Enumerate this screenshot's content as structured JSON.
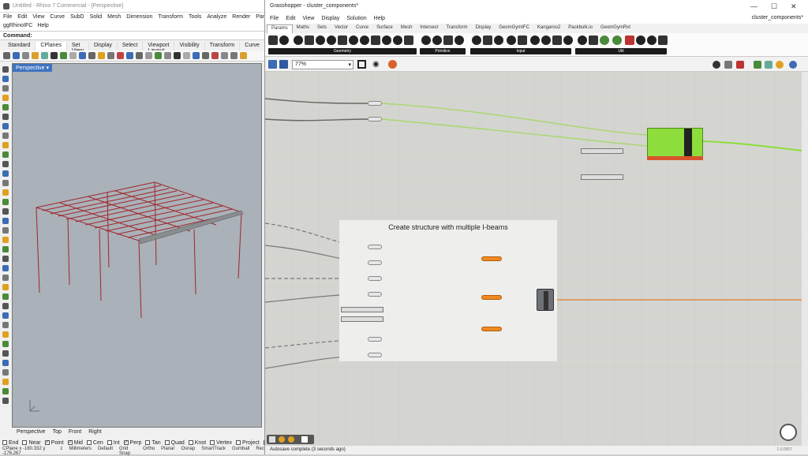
{
  "rhino": {
    "title": "Untitled - Rhino 7 Commercial - [Perspective]",
    "menu": [
      "File",
      "Edit",
      "View",
      "Curve",
      "SubD",
      "Solid",
      "Mesh",
      "Dimension",
      "Transform",
      "Tools",
      "Analyze",
      "Render",
      "Panels"
    ],
    "plugin_menu": [
      "ggRhinoIFC",
      "Help"
    ],
    "command_label": "Command:",
    "toolbar_tabs": [
      "Standard",
      "CPlanes",
      "Set View",
      "Display",
      "Select",
      "Viewport Layout",
      "Visibility",
      "Transform",
      "Curve"
    ],
    "viewport_label": "Perspective",
    "viewport_tabs": [
      "Perspective",
      "Top",
      "Front",
      "Right"
    ],
    "osnaps": [
      {
        "label": "End",
        "checked": false
      },
      {
        "label": "Near",
        "checked": false
      },
      {
        "label": "Point",
        "checked": true
      },
      {
        "label": "Mid",
        "checked": true
      },
      {
        "label": "Cen",
        "checked": false
      },
      {
        "label": "Int",
        "checked": false
      },
      {
        "label": "Perp",
        "checked": true
      },
      {
        "label": "Tan",
        "checked": false
      },
      {
        "label": "Quad",
        "checked": false
      },
      {
        "label": "Knot",
        "checked": false
      },
      {
        "label": "Vertex",
        "checked": false
      },
      {
        "label": "Project",
        "checked": false
      },
      {
        "label": "Disable",
        "checked": false
      }
    ],
    "status": [
      "CPlane x -180.332 y -176.267",
      "z",
      "Millimeters",
      "Default",
      "Grid Snap",
      "Ortho",
      "Planar",
      "Osnap",
      "SmartTrack",
      "Gumball",
      "Rec"
    ]
  },
  "gh": {
    "title": "Grasshopper - cluster_components*",
    "menu": [
      "File",
      "Edit",
      "View",
      "Display",
      "Solution",
      "Help"
    ],
    "doc_name": "cluster_components*",
    "tabs": [
      "Params",
      "Maths",
      "Sets",
      "Vector",
      "Curve",
      "Surface",
      "Mesh",
      "Intersect",
      "Transform",
      "Display",
      "GeomGymIFC",
      "Kangaroo2",
      "Packbulk.io",
      "GeomGymRvt"
    ],
    "ribbon_groups": [
      "Geometry",
      "Primitive",
      "Input",
      "Util"
    ],
    "zoom": "77%",
    "group_title": "Create structure with multiple I-beams",
    "status": "Autosave complete (3 seconds ago)",
    "version": "1.0.0007"
  },
  "colors": {
    "cluster_green": "#8ddd3c",
    "orange_param": "#f08a24",
    "beam_red": "#a0262b"
  }
}
